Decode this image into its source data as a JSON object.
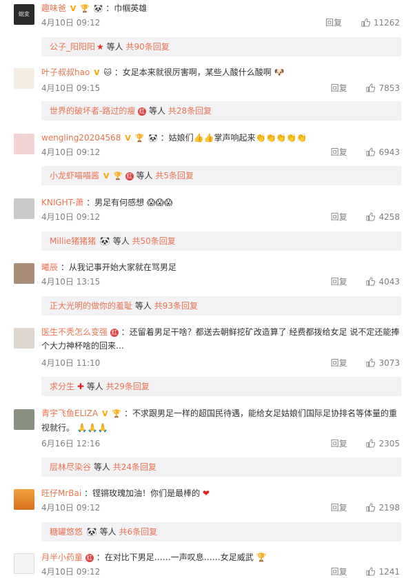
{
  "comments": [
    {
      "name": "趣味爸",
      "badges": [
        "V",
        "🏆",
        "🐼"
      ],
      "text": "巾帼英雄",
      "time": "4月10日 09:12",
      "reply_label": "回复",
      "likes": "11262",
      "avatar_text": "蛻変",
      "sub": {
        "name": "公子_阳阳阳",
        "mid": "等人",
        "count": "共90条回复"
      }
    },
    {
      "name": "叶子叔叔hao",
      "badges": [
        "V",
        "🐱"
      ],
      "text": "女足本来就很厉害啊，某些人酸什么酸啊",
      "emoji": "🐶",
      "time": "4月10日 09:15",
      "reply_label": "回复",
      "likes": "7853",
      "sub": {
        "name": "世界的破坏者-路过的瘦",
        "mid": "等人",
        "count": "共28条回复"
      }
    },
    {
      "name": "wengling20204568",
      "badges": [
        "V",
        "🏆",
        "🐼"
      ],
      "text": "姑娘们👍👍掌声响起来👏👏👏👏👏",
      "time": "4月10日 09:12",
      "reply_label": "回复",
      "likes": "6943",
      "sub": {
        "name": "小龙虾喵喵酱",
        "mid": "等人",
        "count": "共5条回复"
      }
    },
    {
      "name": "KNIGHT-萧",
      "badges": [],
      "text": "男足有何感想",
      "emoji": "😱😱😱",
      "time": "4月10日 09:12",
      "reply_label": "回复",
      "likes": "4258",
      "sub": {
        "name": "Millie猪猪猪",
        "mid": "等人",
        "count": "共50条回复"
      }
    },
    {
      "name": "曦辰",
      "badges": [],
      "text": "从我记事开始大家就在骂男足",
      "time": "4月10日 13:15",
      "reply_label": "回复",
      "likes": "4043",
      "sub": {
        "name": "正大光明的做你的羞耻",
        "mid": "等人",
        "count": "共93条回复"
      }
    },
    {
      "name": "医生不秃怎么变强",
      "badges": [],
      "text": "还留着男足干啥？都送去朝鲜挖矿改造算了 经费都拨给女足 说不定还能捧个大力神杯啥的回来…",
      "time": "4月10日 11:10",
      "reply_label": "回复",
      "likes": "3073",
      "sub": {
        "name": "求分生",
        "mid": "等人",
        "count": "共29条回复"
      }
    },
    {
      "name": "青宇飞鱼ELIZA",
      "badges": [
        "V",
        "🏆"
      ],
      "text": "不求跟男足一样的超国民待遇，能给女足姑娘们国际足协排名等体量的重视就行。",
      "emoji": "🙏🙏🙏",
      "time": "6月16日 12:16",
      "reply_label": "回复",
      "likes": "2305",
      "sub": {
        "name": "层林尽染谷",
        "mid": "等人",
        "count": "共24条回复"
      }
    },
    {
      "name": "旺仔MrBai",
      "badges": [],
      "text": "铿锵玫瑰加油！你们是最棒的",
      "emoji": "❤",
      "time": "4月10日 09:12",
      "reply_label": "回复",
      "likes": "2198",
      "sub": {
        "name": "糖罐悠悠",
        "mid": "等人",
        "count": "共6条回复"
      }
    },
    {
      "name": "月半小药童",
      "badges": [],
      "text": "在对比下男足……一声叹息……女足威武",
      "emoji": "🏆",
      "time": "4月10日 09:12",
      "reply_label": "回复",
      "likes": "1241"
    }
  ],
  "colors": {
    "name": "#eb7350",
    "subbar_bg": "#f2f2f5",
    "meta": "#808080"
  }
}
